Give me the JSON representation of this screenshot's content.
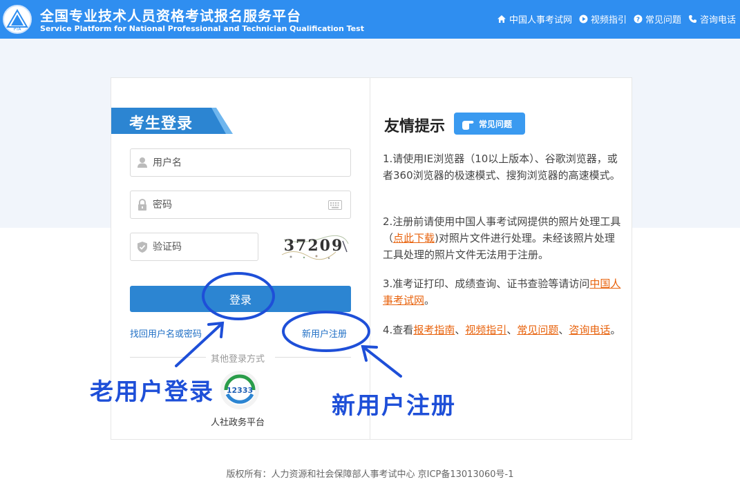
{
  "header": {
    "title": "全国专业技术人员资格考试报名服务平台",
    "subtitle": "Service Platform for National Professional and Technician Qualification Test",
    "logo_text": "PTA",
    "nav": [
      {
        "label": "中国人事考试网",
        "icon": "home-icon"
      },
      {
        "label": "视频指引",
        "icon": "play-icon"
      },
      {
        "label": "常见问题",
        "icon": "question-icon"
      },
      {
        "label": "咨询电话",
        "icon": "phone-icon"
      }
    ]
  },
  "login": {
    "title": "考生登录",
    "username_placeholder": "用户名",
    "password_placeholder": "密码",
    "captcha_placeholder": "验证码",
    "captcha_text": "37209",
    "submit_label": "登录",
    "forgot_label": "找回用户名或密码",
    "register_label": "新用户注册",
    "other_methods_label": "其他登录方式",
    "hrss_logo_text": "12333",
    "hrss_label": "人社政务平台"
  },
  "tips": {
    "title": "友情提示",
    "faq_badge": "常见问题",
    "tip1": "1.请使用IE浏览器（10以上版本）、谷歌浏览器，或者360浏览器的极速模式、搜狗浏览器的高速模式。",
    "tip2_prefix": "2.注册前请使用中国人事考试网提供的照片处理工具（",
    "tip2_link": "点此下载",
    "tip2_suffix": ")对照片文件进行处理。未经该照片处理工具处理的照片文件无法用于注册。",
    "tip3_prefix": "3.准考证打印、成绩查询、证书查验等请访问",
    "tip3_link": "中国人事考试网",
    "tip3_suffix": "。",
    "tip4_prefix": "4.查看",
    "tip4_links": [
      "报考指南",
      "视频指引",
      "常见问题",
      "咨询电话"
    ],
    "tip4_sep": "、",
    "tip4_suffix": "。"
  },
  "annotations": {
    "old_user": "老用户登录",
    "new_user": "新用户注册",
    "color": "#1e4fd8"
  },
  "footer": {
    "copyright": "版权所有：人力资源和社会保障部人事考试中心 京ICP备13013060号-1"
  },
  "colors": {
    "header_bg": "#2f8ef0",
    "button_bg": "#2c85d2",
    "link": "#1f6fc5",
    "accent_link": "#e8620c"
  }
}
